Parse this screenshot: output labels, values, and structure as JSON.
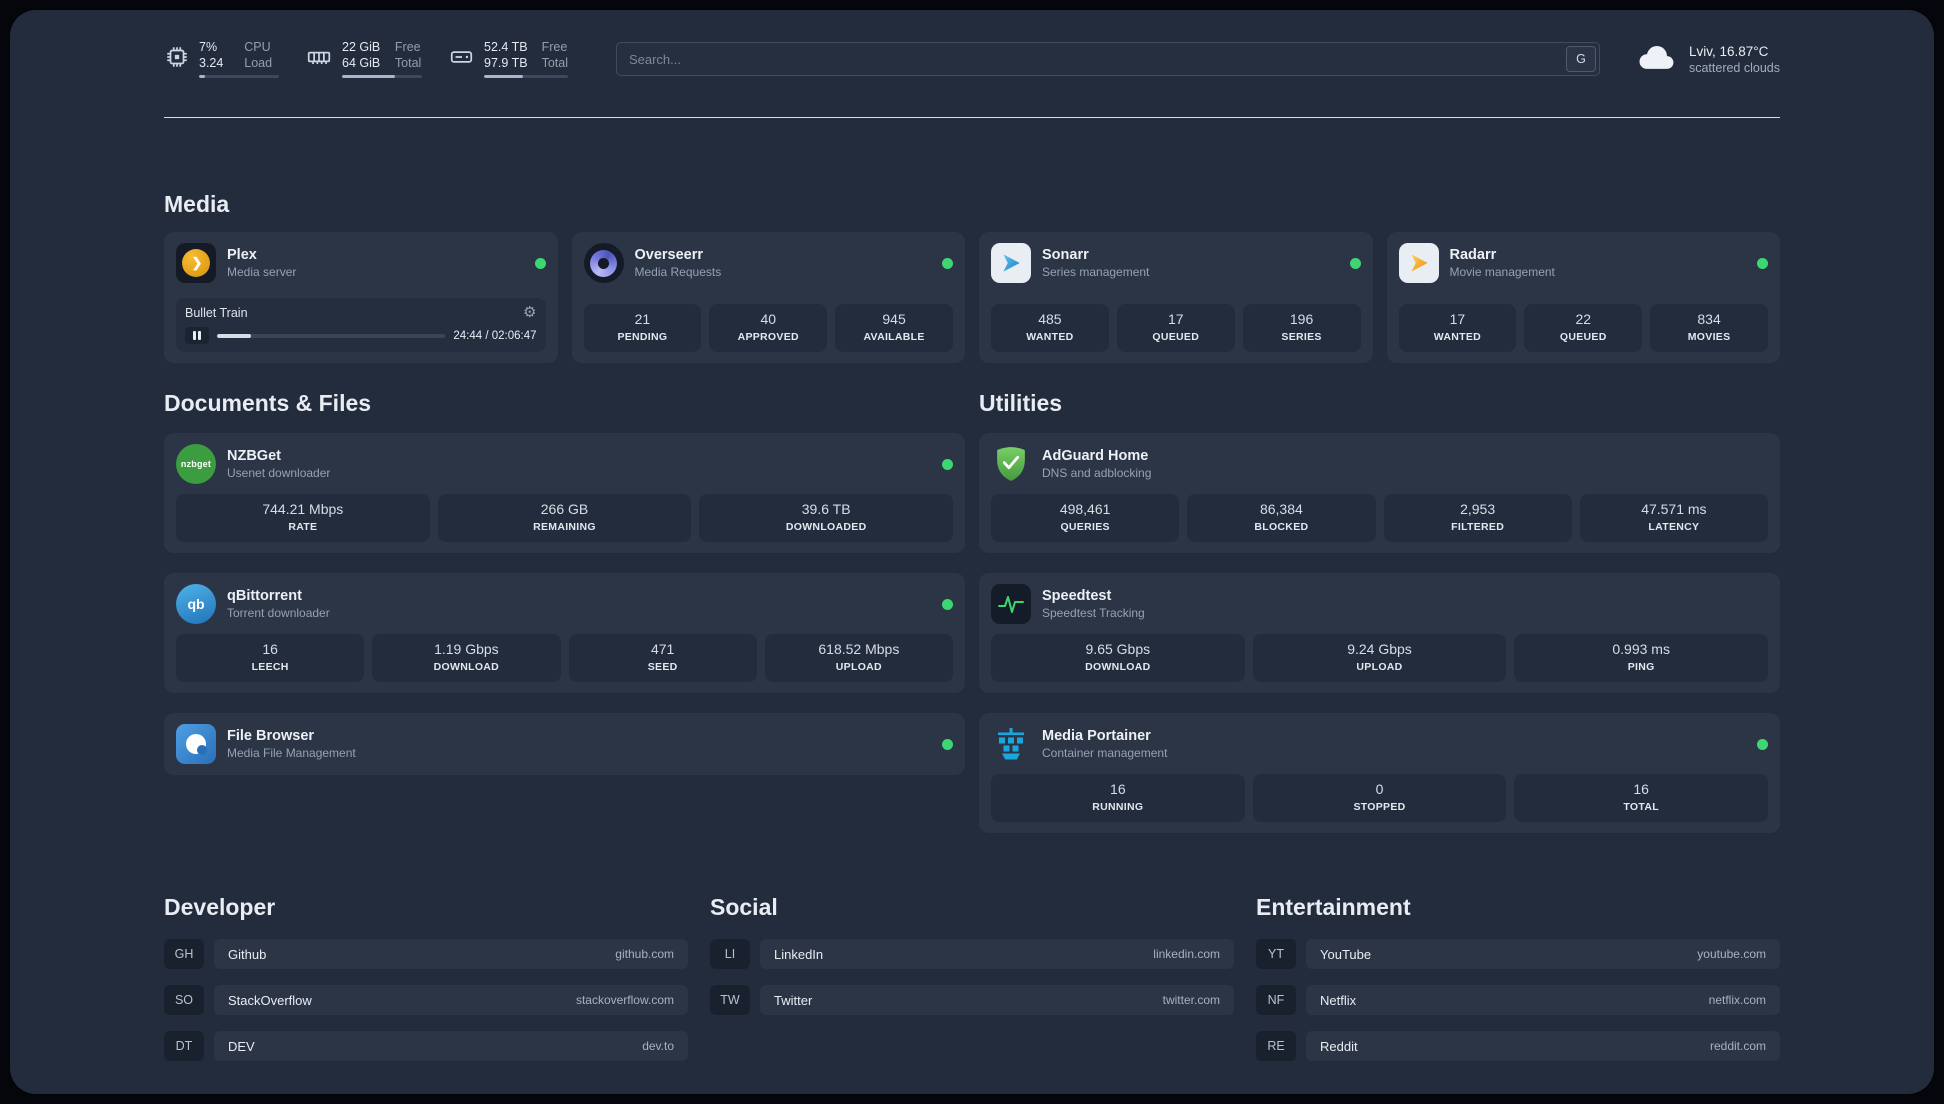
{
  "topbar": {
    "cpu": {
      "value_1": "7%",
      "value_2": "3.24",
      "label_1": "CPU",
      "label_2": "Load",
      "fill_pct": 7
    },
    "ram": {
      "value_1": "22 GiB",
      "value_2": "64 GiB",
      "label_1": "Free",
      "label_2": "Total",
      "fill_pct": 66
    },
    "disk": {
      "value_1": "52.4 TB",
      "value_2": "97.9 TB",
      "label_1": "Free",
      "label_2": "Total",
      "fill_pct": 46
    },
    "search": {
      "placeholder": "Search...",
      "engine_button": "G"
    },
    "weather": {
      "location": "Lviv, 16.87°C",
      "condition": "scattered clouds"
    }
  },
  "section_titles": {
    "media": "Media",
    "documents": "Documents & Files",
    "utilities": "Utilities",
    "developer": "Developer",
    "social": "Social",
    "entertainment": "Entertainment"
  },
  "apps": {
    "plex": {
      "name": "Plex",
      "desc": "Media server",
      "now_playing": {
        "title": "Bullet Train",
        "time": "24:44 / 02:06:47",
        "progress_pct": 15
      }
    },
    "overseerr": {
      "name": "Overseerr",
      "desc": "Media Requests",
      "stats": [
        {
          "value": "21",
          "label": "PENDING"
        },
        {
          "value": "40",
          "label": "APPROVED"
        },
        {
          "value": "945",
          "label": "AVAILABLE"
        }
      ]
    },
    "sonarr": {
      "name": "Sonarr",
      "desc": "Series management",
      "stats": [
        {
          "value": "485",
          "label": "WANTED"
        },
        {
          "value": "17",
          "label": "QUEUED"
        },
        {
          "value": "196",
          "label": "SERIES"
        }
      ]
    },
    "radarr": {
      "name": "Radarr",
      "desc": "Movie management",
      "stats": [
        {
          "value": "17",
          "label": "WANTED"
        },
        {
          "value": "22",
          "label": "QUEUED"
        },
        {
          "value": "834",
          "label": "MOVIES"
        }
      ]
    },
    "nzbget": {
      "name": "NZBGet",
      "desc": "Usenet downloader",
      "stats": [
        {
          "value": "744.21 Mbps",
          "label": "RATE"
        },
        {
          "value": "266 GB",
          "label": "REMAINING"
        },
        {
          "value": "39.6 TB",
          "label": "DOWNLOADED"
        }
      ]
    },
    "qbittorrent": {
      "name": "qBittorrent",
      "desc": "Torrent downloader",
      "stats": [
        {
          "value": "16",
          "label": "LEECH"
        },
        {
          "value": "1.19 Gbps",
          "label": "DOWNLOAD"
        },
        {
          "value": "471",
          "label": "SEED"
        },
        {
          "value": "618.52 Mbps",
          "label": "UPLOAD"
        }
      ]
    },
    "filebrowser": {
      "name": "File Browser",
      "desc": "Media File Management"
    },
    "adguard": {
      "name": "AdGuard Home",
      "desc": "DNS and adblocking",
      "stats": [
        {
          "value": "498,461",
          "label": "QUERIES"
        },
        {
          "value": "86,384",
          "label": "BLOCKED"
        },
        {
          "value": "2,953",
          "label": "FILTERED"
        },
        {
          "value": "47.571 ms",
          "label": "LATENCY"
        }
      ]
    },
    "speedtest": {
      "name": "Speedtest",
      "desc": "Speedtest Tracking",
      "stats": [
        {
          "value": "9.65 Gbps",
          "label": "DOWNLOAD"
        },
        {
          "value": "9.24 Gbps",
          "label": "UPLOAD"
        },
        {
          "value": "0.993 ms",
          "label": "PING"
        }
      ]
    },
    "portainer": {
      "name": "Media Portainer",
      "desc": "Container management",
      "stats": [
        {
          "value": "16",
          "label": "RUNNING"
        },
        {
          "value": "0",
          "label": "STOPPED"
        },
        {
          "value": "16",
          "label": "TOTAL"
        }
      ]
    }
  },
  "bookmarks": {
    "developer": [
      {
        "abbr": "GH",
        "name": "Github",
        "url": "github.com"
      },
      {
        "abbr": "SO",
        "name": "StackOverflow",
        "url": "stackoverflow.com"
      },
      {
        "abbr": "DT",
        "name": "DEV",
        "url": "dev.to"
      }
    ],
    "social": [
      {
        "abbr": "LI",
        "name": "LinkedIn",
        "url": "linkedin.com"
      },
      {
        "abbr": "TW",
        "name": "Twitter",
        "url": "twitter.com"
      }
    ],
    "entertainment": [
      {
        "abbr": "YT",
        "name": "YouTube",
        "url": "youtube.com"
      },
      {
        "abbr": "NF",
        "name": "Netflix",
        "url": "netflix.com"
      },
      {
        "abbr": "RE",
        "name": "Reddit",
        "url": "reddit.com"
      }
    ]
  },
  "icons": {
    "plex_glyph": "❯",
    "gear": "⚙",
    "nzbget_text": "nzbget",
    "qbittorrent_text": "qb"
  },
  "colors": {
    "status_online": "#3ed673",
    "accent_plex": "#e5a00d",
    "accent_sonarr": "#2f9ddb",
    "accent_radarr": "#ef8f1f",
    "accent_nzbget": "#3c9c40",
    "accent_qbittorrent": "#3a9bd9",
    "accent_adguard": "#5bb54c",
    "accent_speedtest": "#3fd66e",
    "accent_portainer": "#1ba7dd"
  }
}
